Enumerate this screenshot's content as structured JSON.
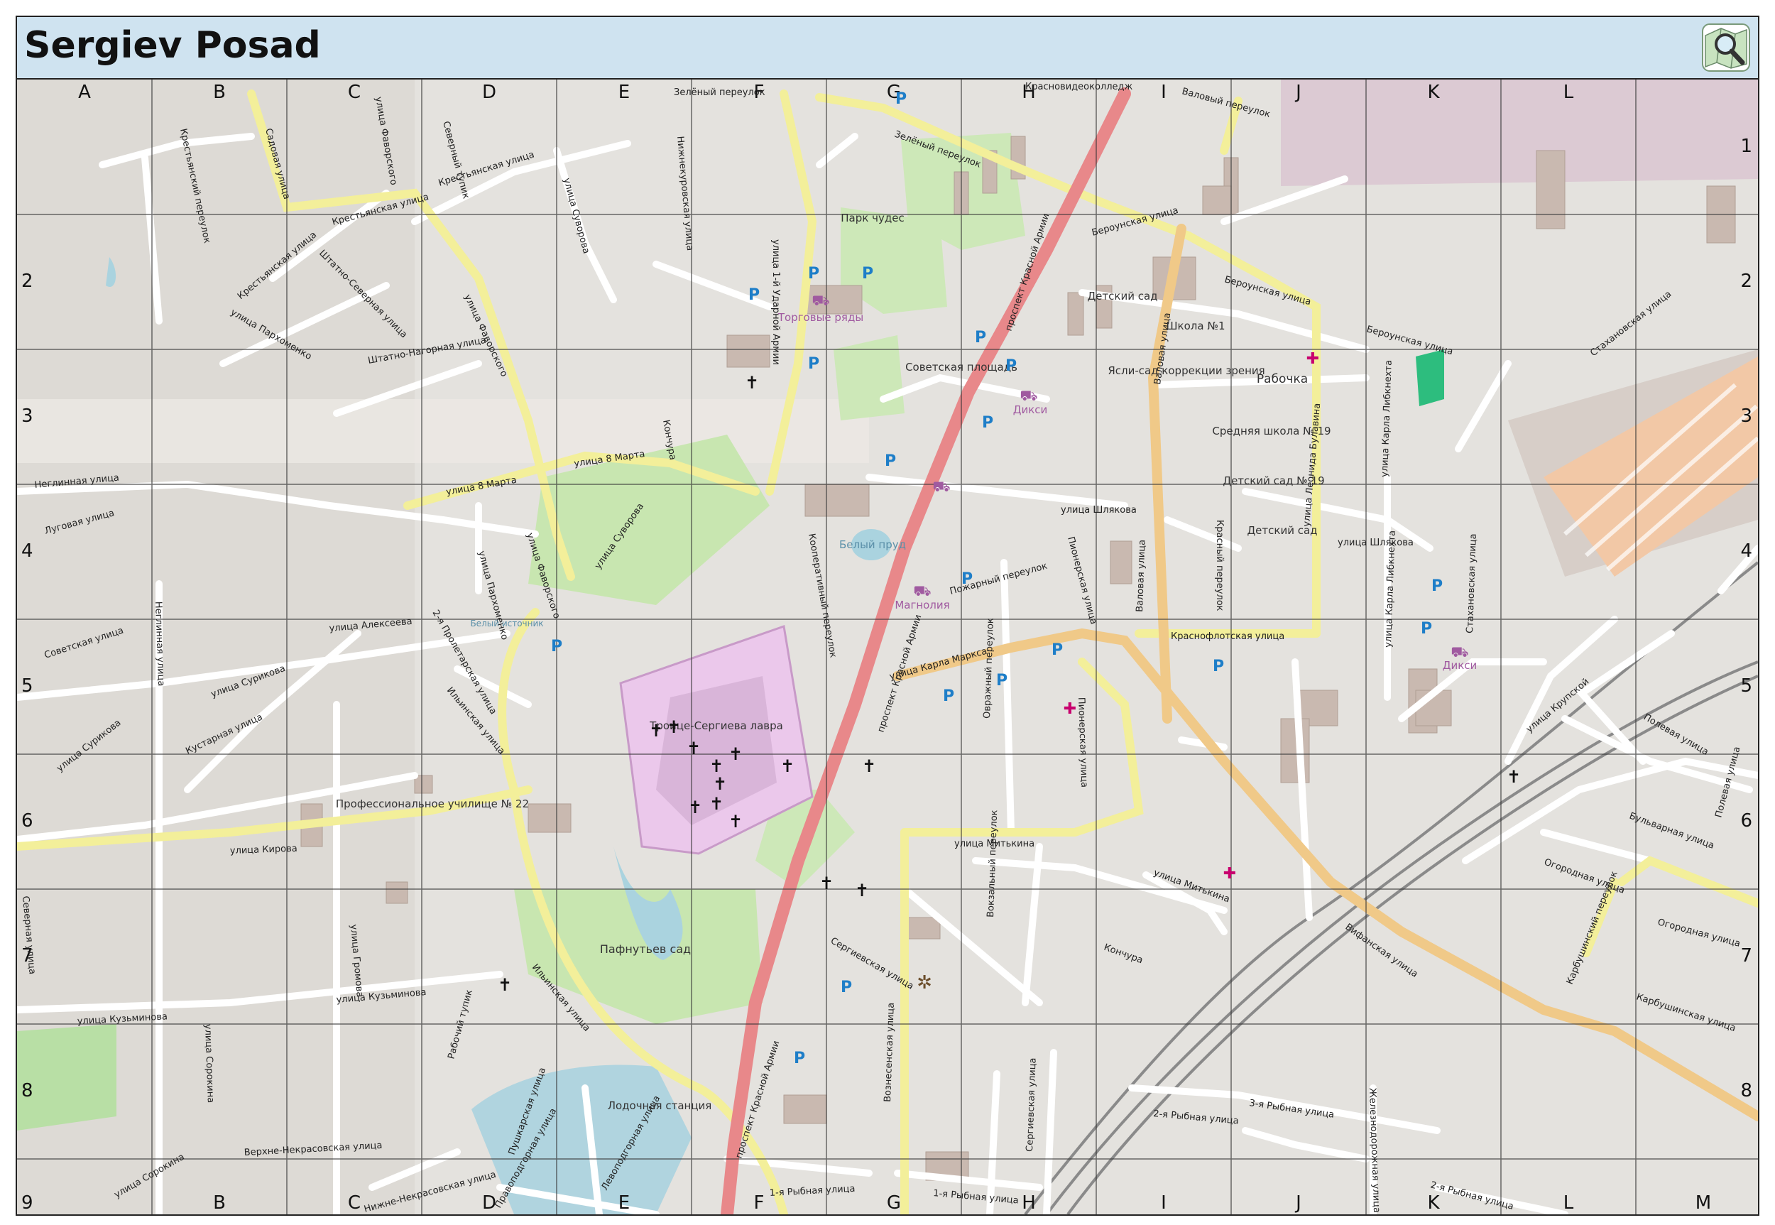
{
  "title": "Sergiev Posad",
  "logo": "openstreetmap-magnifier-logo",
  "grid": {
    "columns": [
      "A",
      "B",
      "C",
      "D",
      "E",
      "F",
      "G",
      "H",
      "I",
      "J",
      "K",
      "L",
      "M"
    ],
    "rows": [
      "1",
      "2",
      "3",
      "4",
      "5",
      "6",
      "7",
      "8",
      "9"
    ]
  },
  "colors": {
    "title_bar": "#cfe3f0",
    "background": "#e4e2de",
    "trunk_road": "#e8888a",
    "secondary_road": "#f4d9a6",
    "tertiary_road": "#f7f4a0",
    "residential_road": "#ffffff",
    "park": "#c8e6b0",
    "religious": "#e8c8e8",
    "water": "#aad3df",
    "building": "#c9b9b0",
    "rail": "#888888",
    "parking_icon": "#1e7ec8",
    "hospital_icon": "#c8006e"
  },
  "streets": {
    "s1": "Зелёный переулок",
    "s2": "Красновидеоколледж",
    "s3": "Валовый переулок",
    "s4": "Крестьянский переулок",
    "s5": "Садовая улица",
    "s6": "улица Фаворского",
    "s7": "Северный тупик",
    "s8": "Крестьянская улица",
    "s9": "Нижнекуровская улица",
    "s10": "улица Суворова",
    "s11": "Крестьянская улица",
    "s12": "Крестьянская улица",
    "s13": "улица Пархоменко",
    "s14": "Штатно-Северная улица",
    "s15": "Штатно-Нагорная улица",
    "s16": "улица Фаворского",
    "s17": "улица 1-й Ударной Армии",
    "s18": "Зелёный переулок",
    "s19": "проспект Красной Армии",
    "s20": "Бероунская улица",
    "s21": "Валовая улица",
    "s22": "Бероунская улица",
    "s23": "Бероунская улица",
    "s24": "Стахановская улица",
    "s25": "улица 8 Марта",
    "s26": "улица 8 Марта",
    "s27": "Неглинная улица",
    "s28": "Луговая улица",
    "s29": "улица Суворова",
    "s30": "улица Фаворского",
    "s31": "Кооперативный переулок",
    "s32": "улица Шлякова",
    "s33": "Валовая улица",
    "s34": "Красный переулок",
    "s35": "улица Леонида Булавина",
    "s36": "улица Карла Либкнехта",
    "s37": "Стахановская улица",
    "s38": "улица Шлякова",
    "s39": "улица Пархоменко",
    "s40": "Пожарный переулок",
    "s41": "Пионерская улица",
    "s42": "улица Алексеева",
    "s43": "Советская улица",
    "s44": "Неглинная улица",
    "s45": "2-я Пролетарская улица",
    "s46": "улица Сурикова",
    "s47": "Ильинская улица",
    "s48": "Кустарная улица",
    "s49": "улица Сурикова",
    "s50": "улица Карла Маркса",
    "s51": "Краснофлотская улица",
    "s52": "Овражный переулок",
    "s53": "Пионерская улица",
    "s54": "улица Карла Либкнехта",
    "s55": "улица Кирова",
    "s56": "улица Митькина",
    "s57": "улица Митькина",
    "s58": "улица Крупской",
    "s59": "Полевая улица",
    "s60": "Бульварная улица",
    "s61": "Полевая улица",
    "s62": "Огородная улица",
    "s63": "Северная улица",
    "s64": "улица Громова",
    "s65": "улица Кузьминова",
    "s66": "Ильинская улица",
    "s67": "Сергиевская улица",
    "s68": "Вокзальный переулок",
    "s69": "Вифанская улица",
    "s70": "Огородная улица",
    "s71": "Карбушинский переулок",
    "s72": "Карбушинская улица",
    "s73": "улица Кузьминова",
    "s74": "улица Сорокина",
    "s75": "Рабочий тупик",
    "s76": "Пушкарская улица",
    "s77": "проспект Красной Армии",
    "s78": "Вознесенская улица",
    "s79": "Сергиевская улица",
    "s80": "2-я Рыбная улица",
    "s81": "3-я Рыбная улица",
    "s82": "Железнодорожная улица",
    "s83": "Верхне-Некрасовская улица",
    "s84": "улица Сорокина",
    "s85": "Нижне-Некрасовская улица",
    "s86": "Правоподгорная улица",
    "s87": "Левоподгорная улица",
    "s88": "1-я Рыбная улица",
    "s89": "1-я Рыбная улица",
    "s90": "2-я Рыбная улица",
    "s91": "проспект Красной Армии",
    "s92": "Кончура",
    "s93": "Кончура"
  },
  "places": {
    "park_wonders": "Парк чудес",
    "trade_rows": "Торговые ряды",
    "soviet_square": "Советская площадь",
    "dixy1": "Дикси",
    "kindergarten": "Детский сад",
    "school1": "Школа №1",
    "nursery_correction": "Ясли-сад коррекции зрения",
    "rabochka": "Рабочка",
    "school19": "Средняя школа № 19",
    "kindergarten19": "Детский сад № 19",
    "kindergarten2": "Детский сад",
    "white_pond": "Белый пруд",
    "magnolia": "Магнолия",
    "dixy2": "Дикси",
    "lavra": "Троице-Сергиева лавра",
    "college22": "Профессиональное училище № 22",
    "pafnutiev_garden": "Пафнутьев сад",
    "boat_station": "Лодочная станция",
    "istochnik": "Белый источник"
  }
}
